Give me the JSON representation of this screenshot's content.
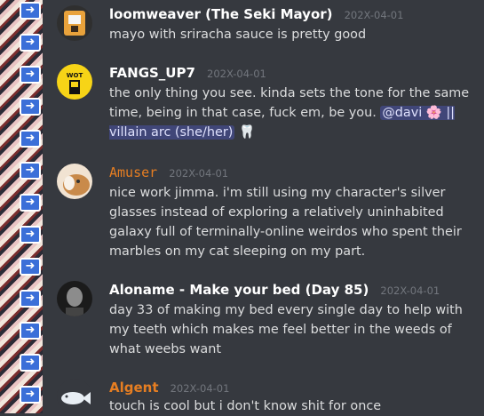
{
  "sidebar": {
    "icon": "reply-arrow-icon"
  },
  "messages": [
    {
      "author": "loomweaver (The Seki Mayor)",
      "timestamp": "202X-04-01",
      "text": "mayo with sriracha sauce is pretty good",
      "avatar_colors": [
        "#e9a23b",
        "#f5f5f5"
      ]
    },
    {
      "author": "FANGS_UP7",
      "timestamp": "202X-04-01",
      "text": "the only thing you see. kinda sets the tone for the same time, being in that case, fuck em, be you.",
      "mention": "@davi 🌸 || villain arc (she/her)",
      "emoji": "🦷",
      "avatar_text": "WOT",
      "avatar_colors": [
        "#f7d417",
        "#111111"
      ]
    },
    {
      "author": "Amuser",
      "timestamp": "202X-04-01",
      "text": "nice work jimma. i'm still using my character's silver glasses instead of exploring a relatively uninhabited galaxy full of terminally-online weirdos who spent their marbles on my cat sleeping on my part.",
      "author_color": "#e67e22",
      "avatar_colors": [
        "#c98a4a",
        "#f1e3d2"
      ]
    },
    {
      "author": "Aloname - Make your bed (Day 85)",
      "timestamp": "202X-04-01",
      "text": "day 33 of making my bed every single day to help with my teeth which makes me feel better in the weeds of what weebs want",
      "avatar_colors": [
        "#1b1b1b",
        "#8c8c8c"
      ]
    },
    {
      "author": "Algent",
      "timestamp": "202X-04-01",
      "text": "touch is cool but i don't know shit for once",
      "author_color": "#e67e22",
      "avatar_colors": [
        "#36393f",
        "#e8eef4"
      ]
    }
  ]
}
